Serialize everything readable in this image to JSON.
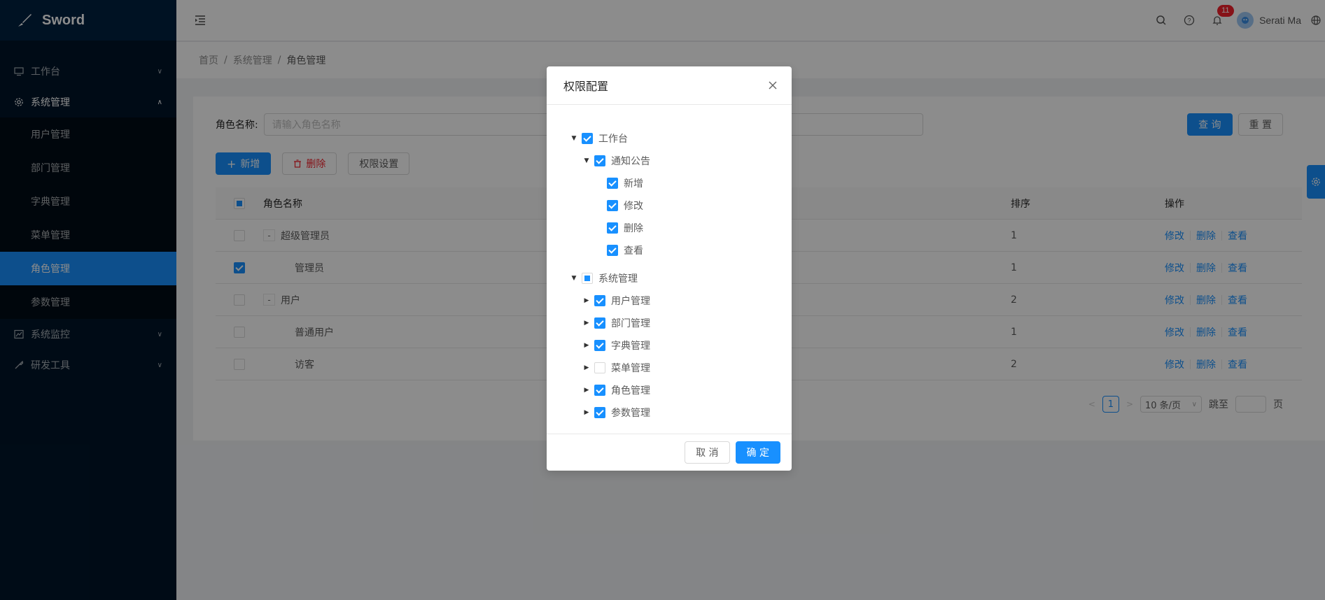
{
  "app": {
    "name": "Sword"
  },
  "sidebar": {
    "items": [
      {
        "label": "工作台",
        "icon": "monitor-icon",
        "arrow": "∨"
      },
      {
        "label": "系统管理",
        "icon": "gear-icon",
        "arrow": "∧"
      },
      {
        "label": "系统监控",
        "icon": "chart-icon",
        "arrow": "∨"
      },
      {
        "label": "研发工具",
        "icon": "tool-icon",
        "arrow": "∨"
      }
    ],
    "submenu": [
      {
        "label": "用户管理"
      },
      {
        "label": "部门管理"
      },
      {
        "label": "字典管理"
      },
      {
        "label": "菜单管理"
      },
      {
        "label": "角色管理",
        "active": true
      },
      {
        "label": "参数管理"
      }
    ]
  },
  "header": {
    "notification_count": "11",
    "user_name": "Serati Ma"
  },
  "breadcrumb": {
    "home": "首页",
    "parent": "系统管理",
    "current": "角色管理",
    "separator": "/"
  },
  "search": {
    "label": "角色名称:",
    "placeholder": "请输入角色名称",
    "query_button": "查 询",
    "reset_button": "重 置"
  },
  "actions": {
    "add": "新增",
    "delete": "删除",
    "permission": "权限设置"
  },
  "table": {
    "headers": {
      "name": "角色名称",
      "sort": "排序",
      "ops": "操作"
    },
    "ops": {
      "edit": "修改",
      "delete": "删除",
      "view": "查看"
    },
    "rows": [
      {
        "name": "超级管理员",
        "sort": "1",
        "expand": "-"
      },
      {
        "name": "管理员",
        "sort": "1",
        "checked": true
      },
      {
        "name": "用户",
        "sort": "2",
        "expand": "-"
      },
      {
        "name": "普通用户",
        "sort": "1"
      },
      {
        "name": "访客",
        "sort": "2"
      }
    ]
  },
  "pagination": {
    "page": "1",
    "page_size": "10 条/页",
    "jump_label": "跳至",
    "page_suffix": "页"
  },
  "modal": {
    "title": "权限配置",
    "cancel": "取 消",
    "ok": "确 定",
    "tree": [
      {
        "label": "工作台",
        "state": "checked",
        "switcher": "▼",
        "level": 0
      },
      {
        "label": "通知公告",
        "state": "checked",
        "switcher": "▼",
        "level": 1
      },
      {
        "label": "新增",
        "state": "checked",
        "level": 2
      },
      {
        "label": "修改",
        "state": "checked",
        "level": 2
      },
      {
        "label": "删除",
        "state": "checked",
        "level": 2
      },
      {
        "label": "查看",
        "state": "checked",
        "level": 2
      },
      {
        "label": "系统管理",
        "state": "indeterminate",
        "switcher": "▼",
        "level": 0
      },
      {
        "label": "用户管理",
        "state": "checked",
        "switcher": "▶",
        "level": 1
      },
      {
        "label": "部门管理",
        "state": "checked",
        "switcher": "▶",
        "level": 1
      },
      {
        "label": "字典管理",
        "state": "checked",
        "switcher": "▶",
        "level": 1
      },
      {
        "label": "菜单管理",
        "state": "unchecked",
        "switcher": "▶",
        "level": 1
      },
      {
        "label": "角色管理",
        "state": "checked",
        "switcher": "▶",
        "level": 1
      },
      {
        "label": "参数管理",
        "state": "checked",
        "switcher": "▶",
        "level": 1
      }
    ]
  },
  "colors": {
    "primary": "#1890ff",
    "sidebar_bg": "#001529",
    "danger": "#f5222d"
  }
}
